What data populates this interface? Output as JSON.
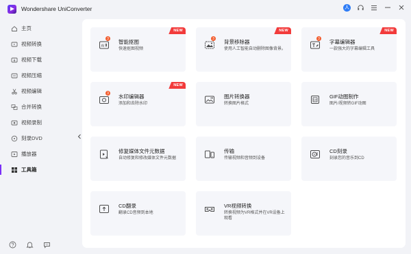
{
  "app": {
    "title": "Wondershare UniConverter",
    "accent": "#7b2ff7",
    "avatar_letter": "人"
  },
  "titlebar_icons": [
    "user-avatar",
    "headset-icon",
    "menu-icon",
    "minimize-icon",
    "close-icon"
  ],
  "sidebar": {
    "items": [
      {
        "label": "主页",
        "icon": "home-icon"
      },
      {
        "label": "视频转换",
        "icon": "convert-icon"
      },
      {
        "label": "视频下载",
        "icon": "download-icon"
      },
      {
        "label": "视频压缩",
        "icon": "compress-icon"
      },
      {
        "label": "视频编辑",
        "icon": "scissors-icon"
      },
      {
        "label": "合并转换",
        "icon": "merge-icon"
      },
      {
        "label": "视频录制",
        "icon": "record-icon"
      },
      {
        "label": "刻录DVD",
        "icon": "dvd-icon"
      },
      {
        "label": "播放器",
        "icon": "player-icon"
      },
      {
        "label": "工具箱",
        "icon": "toolbox-icon",
        "active": true
      }
    ],
    "bottom_icons": [
      "help-icon",
      "bell-icon",
      "feedback-icon"
    ]
  },
  "tools": [
    {
      "title": "智能抠图",
      "desc": "快速抠图视频",
      "badge": "NEW",
      "dot": "3",
      "icon": "ai-portrait-icon"
    },
    {
      "title": "背景移除器",
      "desc": "使用人工智能自动删除图像背景。",
      "badge": "NEW",
      "dot": "3",
      "icon": "background-remover-icon"
    },
    {
      "title": "字幕编辑器",
      "desc": "一款强大的字幕编辑工具",
      "badge": "NEW",
      "dot": "3",
      "icon": "subtitle-editor-icon"
    },
    {
      "title": "水印编辑器",
      "desc": "添加和去除水印",
      "badge": "NEW",
      "dot": "3",
      "icon": "watermark-editor-icon"
    },
    {
      "title": "图片转换器",
      "desc": "转换图片格式",
      "badge": "",
      "dot": "",
      "icon": "image-converter-icon"
    },
    {
      "title": "GIF动图制作",
      "desc": "图片/视频转GIF动图",
      "badge": "",
      "dot": "",
      "icon": "gif-maker-icon"
    },
    {
      "title": "修复媒体文件元数据",
      "desc": "自动修复和修改媒体文件元数据",
      "badge": "",
      "dot": "",
      "icon": "fix-metadata-icon"
    },
    {
      "title": "传输",
      "desc": "传输视频和音频到设备",
      "badge": "",
      "dot": "",
      "icon": "transfer-icon"
    },
    {
      "title": "CD刻录",
      "desc": "刻录您的音乐到CD",
      "badge": "",
      "dot": "",
      "icon": "cd-burner-icon"
    },
    {
      "title": "CD翻录",
      "desc": "翻录CD音频到本地",
      "badge": "",
      "dot": "",
      "icon": "cd-ripper-icon"
    },
    {
      "title": "VR视频转换",
      "desc": "转换视频为VR格式并在VR设备上观看",
      "badge": "",
      "dot": "",
      "icon": "vr-converter-icon"
    }
  ]
}
